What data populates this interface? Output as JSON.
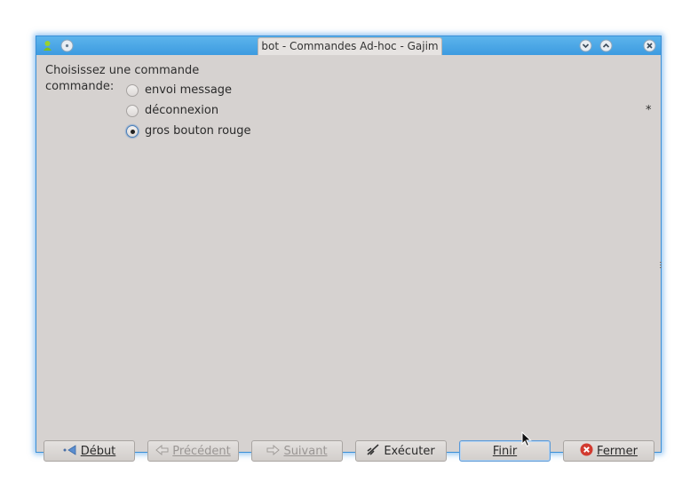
{
  "window": {
    "title": "bot - Commandes Ad-hoc - Gajim"
  },
  "form": {
    "instructions": "Choisissez une commande",
    "field_label": "commande:",
    "required_marker": "*",
    "options": [
      {
        "label": "envoi message",
        "selected": false
      },
      {
        "label": "déconnexion",
        "selected": false
      },
      {
        "label": "gros bouton rouge",
        "selected": true
      }
    ]
  },
  "buttons": {
    "first": {
      "label": "Début",
      "mnemonic": "D",
      "icon": "go-first-icon",
      "enabled": true
    },
    "prev": {
      "label": "Précédent",
      "mnemonic": "P",
      "icon": "go-back-icon",
      "enabled": false
    },
    "next": {
      "label": "Suivant",
      "mnemonic": "S",
      "icon": "go-forward-icon",
      "enabled": false
    },
    "execute": {
      "label": "Exécuter",
      "mnemonic": "x",
      "icon": "execute-icon",
      "enabled": true
    },
    "finish": {
      "label": "Finir",
      "mnemonic": "F",
      "enabled": true
    },
    "close": {
      "label": "Fermer",
      "mnemonic": "F",
      "icon": "close-icon",
      "enabled": true
    }
  },
  "colors": {
    "titlebar": "#3d9be0",
    "window_bg": "#d6d2d0",
    "close_icon": "#d23b30"
  }
}
